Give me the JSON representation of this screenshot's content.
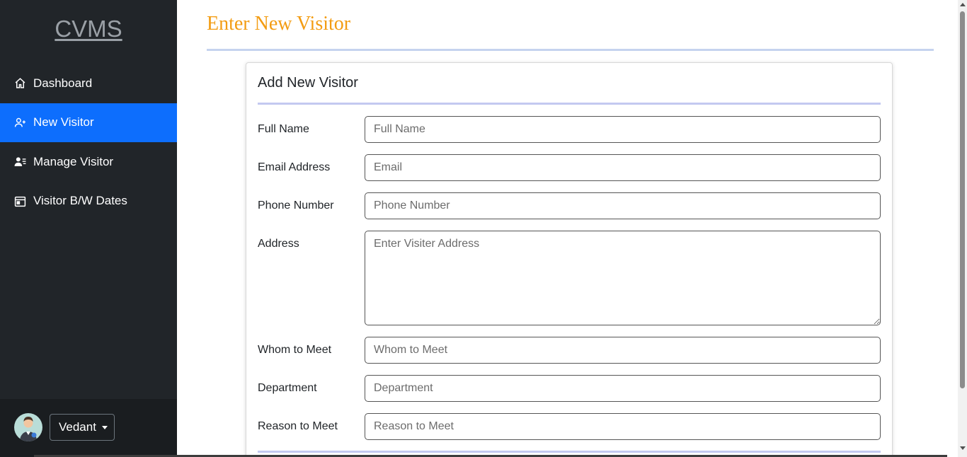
{
  "brand": "CVMS",
  "sidebar": {
    "items": [
      {
        "label": "Dashboard",
        "icon": "home-icon",
        "active": false
      },
      {
        "label": "New Visitor",
        "icon": "person-plus-icon",
        "active": true
      },
      {
        "label": "Manage Visitor",
        "icon": "person-lines-icon",
        "active": false
      },
      {
        "label": "Visitor B/W Dates",
        "icon": "calendar-icon",
        "active": false
      }
    ],
    "user": {
      "name": "Vedant",
      "avatar": "user-avatar-icon"
    }
  },
  "page": {
    "title": "Enter New Visitor"
  },
  "form": {
    "title": "Add New Visitor",
    "fields": [
      {
        "label": "Full Name",
        "placeholder": "Full Name",
        "value": ""
      },
      {
        "label": "Email Address",
        "placeholder": "Email",
        "value": ""
      },
      {
        "label": "Phone Number",
        "placeholder": "Phone Number",
        "value": ""
      },
      {
        "label": "Address",
        "placeholder": "Enter Visiter Address",
        "value": ""
      },
      {
        "label": "Whom to Meet",
        "placeholder": "Whom to Meet",
        "value": ""
      },
      {
        "label": "Department",
        "placeholder": "Department",
        "value": ""
      },
      {
        "label": "Reason to Meet",
        "placeholder": "Reason to Meet",
        "value": ""
      }
    ]
  },
  "colors": {
    "accent": "#0d6efd",
    "sidebar_bg": "#212529",
    "title_color": "#f39c12"
  }
}
